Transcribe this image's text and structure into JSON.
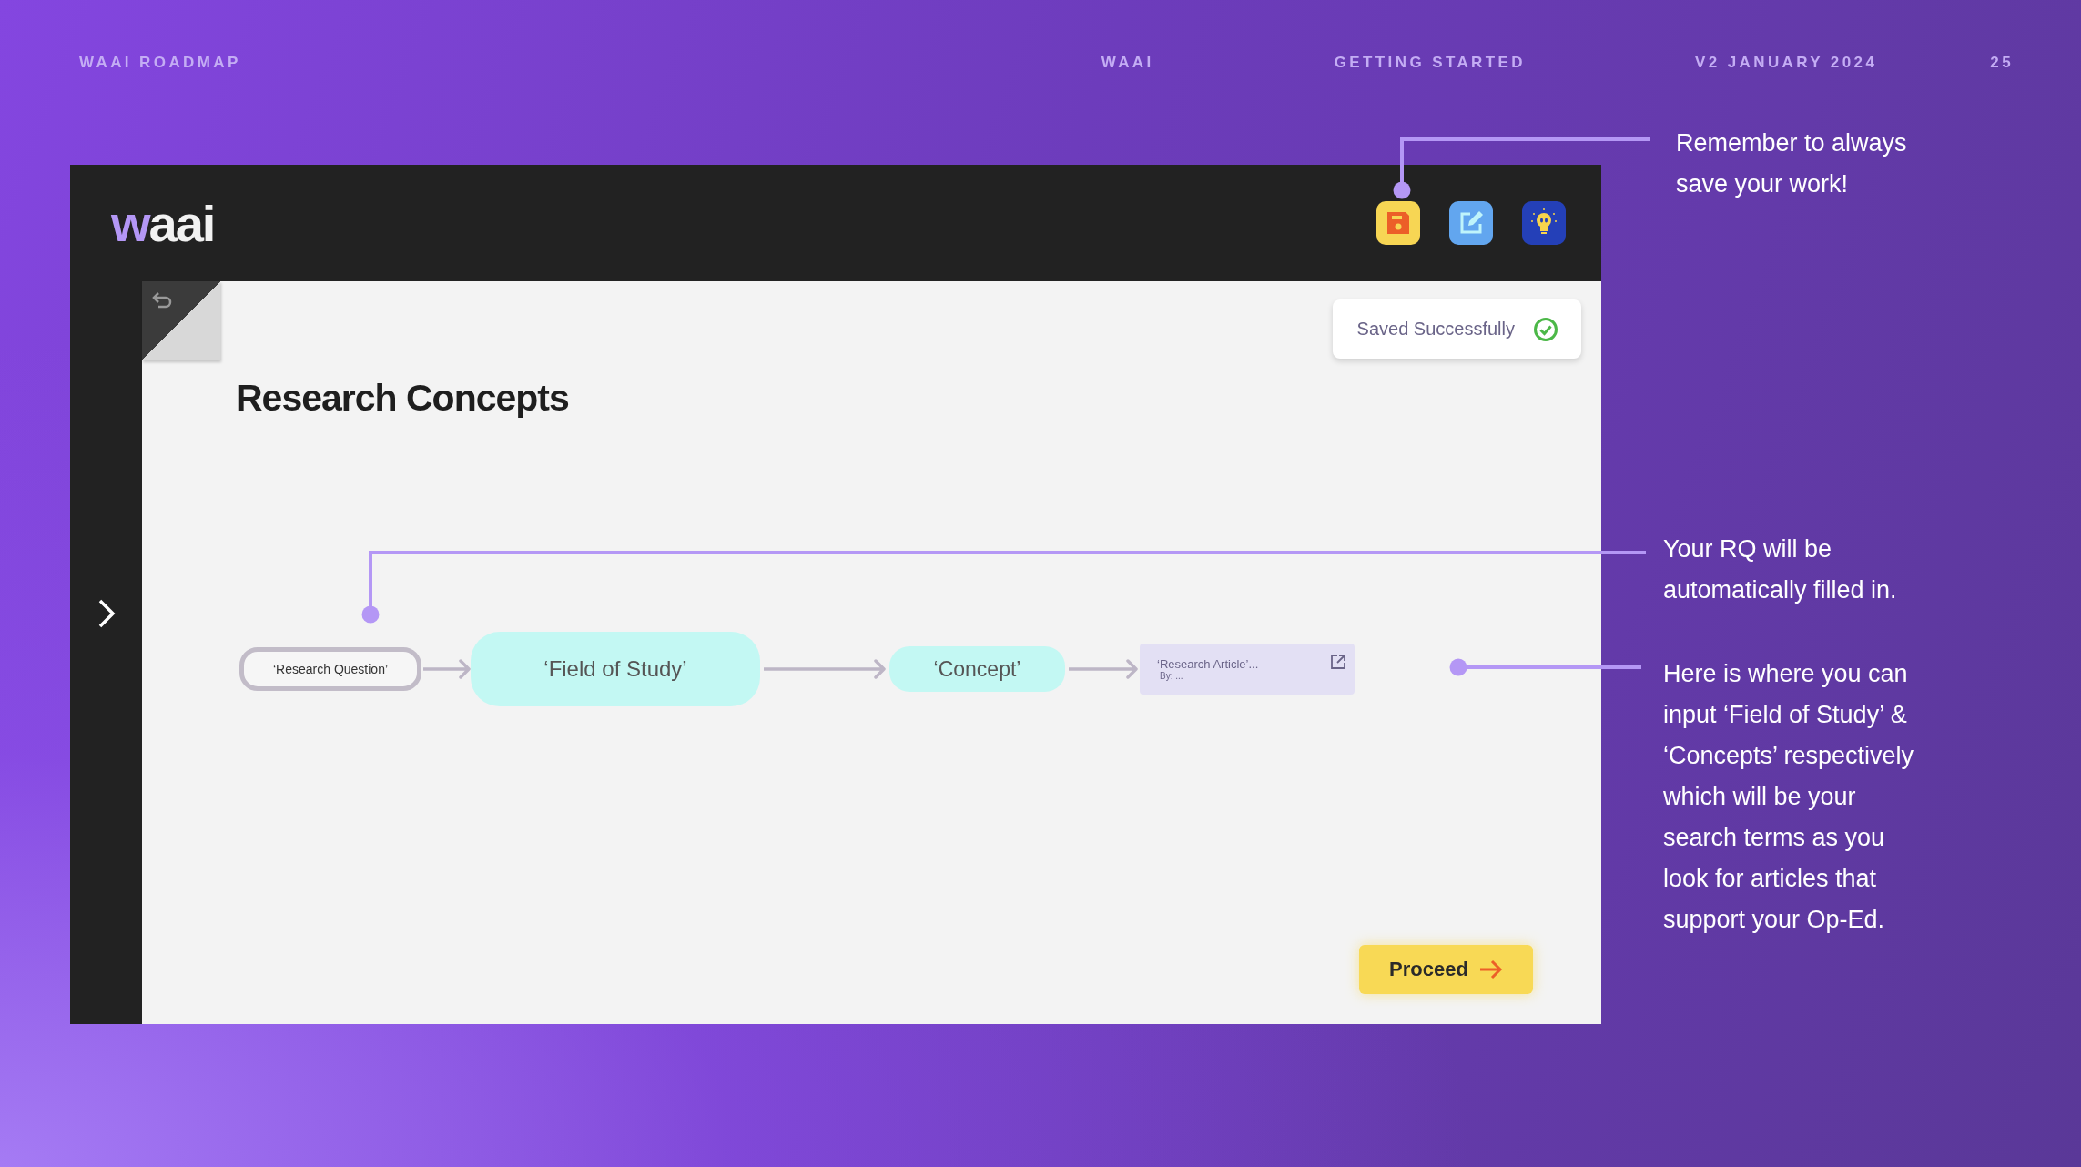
{
  "slide_header": [
    {
      "text": "WAAI ROADMAP"
    },
    {
      "text": "WAAI"
    },
    {
      "text": "GETTING STARTED"
    },
    {
      "text": "V2 JANUARY 2024"
    },
    {
      "text": "25"
    }
  ],
  "app": {
    "logo": "waai",
    "toolbar": [
      {
        "kind": "save"
      },
      {
        "kind": "edit"
      },
      {
        "kind": "idea"
      }
    ],
    "toast": {
      "text": "Saved Successfully"
    },
    "title": "Research Concepts",
    "flow": [
      {
        "kind": "question",
        "label": "‘Research Question’"
      },
      {
        "kind": "field",
        "label": "‘Field of Study’"
      },
      {
        "kind": "concept",
        "label": "‘Concept’"
      },
      {
        "kind": "article",
        "label": "‘Research Article’...",
        "byline": "By: ..."
      }
    ],
    "proceed_button": "Proceed"
  },
  "callouts": [
    {
      "lines": [
        "Remember to always",
        "save your work!"
      ]
    },
    {
      "lines": [
        "Your RQ will be",
        "automatically filled in."
      ]
    },
    {
      "lines": [
        "Here is where you can",
        "input ‘Field of Study’ &",
        "‘Concepts’ respectively",
        "which will be your",
        "search terms as you",
        "look for articles that",
        "support your Op-Ed."
      ]
    }
  ]
}
